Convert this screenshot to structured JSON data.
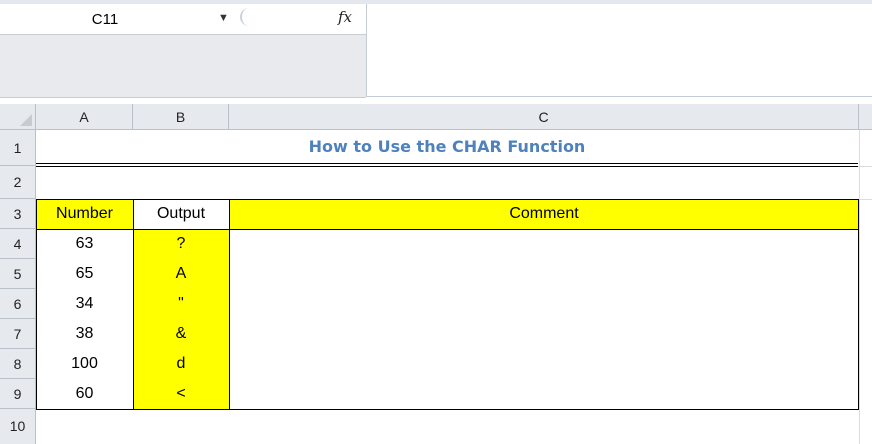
{
  "formula_bar": {
    "name_box": "C11",
    "fx_label": "fx",
    "formula": ""
  },
  "columns": [
    "A",
    "B",
    "C"
  ],
  "rows": [
    "1",
    "2",
    "3",
    "4",
    "5",
    "6",
    "7",
    "8",
    "9",
    "10"
  ],
  "sheet": {
    "title": "How to Use the CHAR Function",
    "headers": {
      "number": "Number",
      "output": "Output",
      "comment": "Comment"
    },
    "data": [
      {
        "number": "63",
        "output": "?"
      },
      {
        "number": "65",
        "output": "A"
      },
      {
        "number": "34",
        "output": "\""
      },
      {
        "number": "38",
        "output": "&"
      },
      {
        "number": "100",
        "output": "d"
      },
      {
        "number": "60",
        "output": "<"
      }
    ]
  },
  "colors": {
    "title": "#4f81bd",
    "highlight": "#ffff00"
  }
}
